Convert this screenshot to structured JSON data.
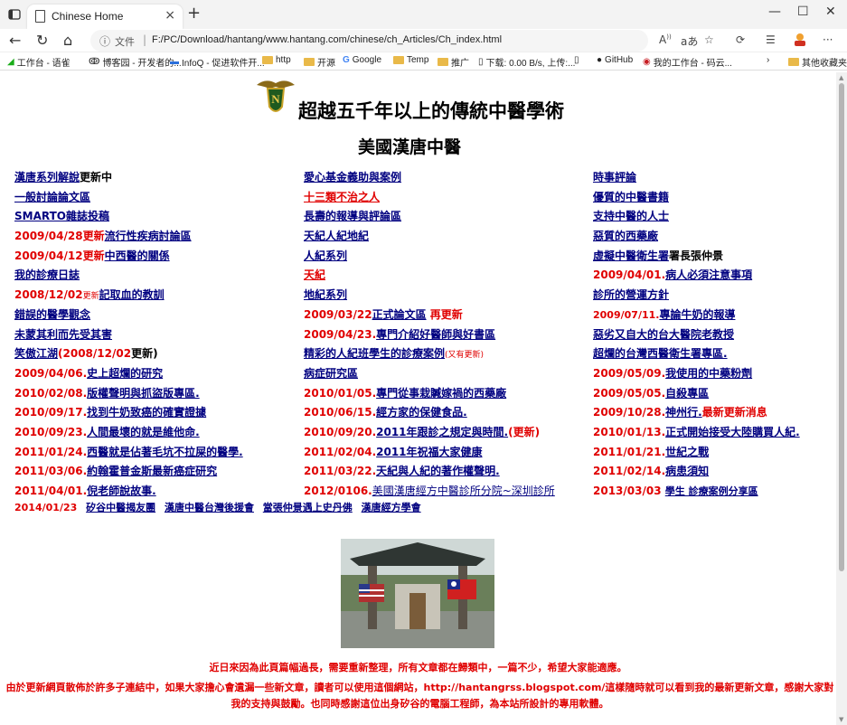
{
  "browser": {
    "tab_title": "Chinese Home",
    "url_scheme": "文件",
    "url": "F:/PC/Download/hantang/www.hantang.com/chinese/ch_Articles/Ch_index.html",
    "bookmarks": [
      {
        "label": "工作台 - 语雀",
        "icon": "yuque-icon"
      },
      {
        "label": "博客园 - 开发者的...",
        "icon": "cnblogs-icon"
      },
      {
        "label": "InfoQ - 促进软件开...",
        "icon": "infoq-icon"
      },
      {
        "label": "http",
        "icon": "folder-icon"
      },
      {
        "label": "开源",
        "icon": "folder-icon"
      },
      {
        "label": "Google",
        "icon": "google-icon"
      },
      {
        "label": "Temp",
        "icon": "folder-icon"
      },
      {
        "label": "推广",
        "icon": "folder-icon"
      },
      {
        "label": "下载: 0.00 B/s, 上传:...",
        "icon": "page-icon"
      },
      {
        "label": "",
        "icon": "page-icon"
      },
      {
        "label": "GitHub",
        "icon": "github-icon"
      },
      {
        "label": "我的工作台 - 码云...",
        "icon": "gitee-icon"
      },
      {
        "label": "其他收藏夹",
        "icon": "folder-icon"
      }
    ]
  },
  "header": {
    "title": "超越五千年以上的傳統中醫學術",
    "subtitle": "美國漢唐中醫"
  },
  "columns": {
    "left": [
      [
        {
          "t": "漢唐系列解說",
          "s": "link"
        },
        {
          "t": "更新中",
          "s": "plain"
        }
      ],
      [
        {
          "t": "一般討論論文區",
          "s": "link"
        }
      ],
      [
        {
          "t": "SMARTO雜誌投稿",
          "s": "link"
        }
      ],
      [
        {
          "t": "2009/04/28更新",
          "s": "red"
        },
        {
          "t": "流行性疾病討論區",
          "s": "link"
        }
      ],
      [
        {
          "t": "2009/04/12更新",
          "s": "red"
        },
        {
          "t": "中西醫的關係",
          "s": "link"
        }
      ],
      [
        {
          "t": "我的診療日誌",
          "s": "link"
        }
      ],
      [
        {
          "t": "2008/12/02",
          "s": "red"
        },
        {
          "t": "更新",
          "s": "redsmall"
        },
        {
          "t": "記取血的教訓",
          "s": "link"
        }
      ],
      [
        {
          "t": "錯誤的醫學觀念",
          "s": "link"
        }
      ],
      [
        {
          "t": "未蒙其利而先受其害",
          "s": "link"
        }
      ],
      [
        {
          "t": "笑傲江湖",
          "s": "link"
        },
        {
          "t": "(2008/12/02",
          "s": "red"
        },
        {
          "t": "更新)",
          "s": "plain"
        }
      ],
      [
        {
          "t": "2009/04/06.",
          "s": "red"
        },
        {
          "t": "史上超爛的研究",
          "s": "link"
        }
      ],
      [
        {
          "t": "2010/02/08.",
          "s": "red"
        },
        {
          "t": "版權聲明與抓盜版專區.",
          "s": "link"
        }
      ],
      [
        {
          "t": "2010/09/17.",
          "s": "red"
        },
        {
          "t": "找到牛奶致癌的確實證據",
          "s": "link"
        }
      ],
      [
        {
          "t": "2010/09/23.",
          "s": "red"
        },
        {
          "t": "人間最壞的就是維他命.",
          "s": "link"
        }
      ],
      [
        {
          "t": "2011/01/24.",
          "s": "red"
        },
        {
          "t": "西醫就是佔著毛坑不拉屎的醫學.",
          "s": "link"
        }
      ],
      [
        {
          "t": "2011/03/06.",
          "s": "red"
        },
        {
          "t": "約翰霍普金斯最新癌症研究",
          "s": "link"
        }
      ],
      [
        {
          "t": "2011/04/01.",
          "s": "red"
        },
        {
          "t": "倪老師說故事.",
          "s": "link"
        }
      ]
    ],
    "middle": [
      [
        {
          "t": "愛心基金義助與案例",
          "s": "link"
        }
      ],
      [
        {
          "t": "十三類不治之人",
          "s": "redlink"
        }
      ],
      [
        {
          "t": "長壽的報導與評論區",
          "s": "link"
        }
      ],
      [
        {
          "t": "天紀人紀地紀",
          "s": "link"
        }
      ],
      [
        {
          "t": "人紀系列",
          "s": "link"
        }
      ],
      [
        {
          "t": "天紀",
          "s": "redlink"
        }
      ],
      [
        {
          "t": "地紀系列",
          "s": "link"
        }
      ],
      [
        {
          "t": "2009/03/22",
          "s": "red"
        },
        {
          "t": "正式論文區",
          "s": "link"
        },
        {
          "t": " 再更新",
          "s": "red"
        }
      ],
      [
        {
          "t": "2009/04/23.",
          "s": "red"
        },
        {
          "t": "專門介紹好醫師與好書區",
          "s": "link"
        }
      ],
      [
        {
          "t": "精彩的人紀班學生的診療案例",
          "s": "link"
        },
        {
          "t": "(又有更新)",
          "s": "redsmall"
        }
      ],
      [
        {
          "t": "病症研究區",
          "s": "link"
        }
      ],
      [
        {
          "t": "2010/01/05.",
          "s": "red"
        },
        {
          "t": "專門從事栽贓嫁禍的西藥廠",
          "s": "link"
        }
      ],
      [
        {
          "t": "2010/06/15.",
          "s": "red"
        },
        {
          "t": "經方家的保健食品.",
          "s": "link"
        }
      ],
      [
        {
          "t": "2010/09/20.",
          "s": "red"
        },
        {
          "t": "2011年跟診之規定與時間.",
          "s": "link"
        },
        {
          "t": "(更新)",
          "s": "red"
        }
      ],
      [
        {
          "t": "2011/02/04.",
          "s": "red"
        },
        {
          "t": "2011年祝福大家健康",
          "s": "link"
        }
      ],
      [
        {
          "t": "2011/03/22.",
          "s": "red"
        },
        {
          "t": "天紀與人紀的著作權聲明.",
          "s": "link"
        }
      ],
      [
        {
          "t": "2012/0106.",
          "s": "red"
        },
        {
          "t": "美國漢唐經方中醫診所分院~深圳診所",
          "s": "linknormal"
        }
      ]
    ],
    "right": [
      [
        {
          "t": "時事評論",
          "s": "link"
        }
      ],
      [
        {
          "t": "優質的中醫書籍",
          "s": "link"
        }
      ],
      [
        {
          "t": "支持中醫的人士",
          "s": "link"
        }
      ],
      [
        {
          "t": "惡質的西藥廠",
          "s": "link"
        }
      ],
      [
        {
          "t": "虛擬中醫衛生署",
          "s": "link"
        },
        {
          "t": "署長張仲景",
          "s": "plain"
        }
      ],
      [
        {
          "t": "2009/04/01.",
          "s": "red"
        },
        {
          "t": "病人必須注意事項",
          "s": "link"
        }
      ],
      [
        {
          "t": "診所的營運方針",
          "s": "link"
        }
      ],
      [
        {
          "t": "2009/07/11.",
          "s": "redsm"
        },
        {
          "t": "專論牛奶的報導",
          "s": "link"
        }
      ],
      [
        {
          "t": "惡劣又自大的台大醫院老教授",
          "s": "link"
        }
      ],
      [
        {
          "t": "超爛的台灣西醫衛生署專區.",
          "s": "link"
        }
      ],
      [
        {
          "t": "2009/05/09.",
          "s": "red"
        },
        {
          "t": "我使用的中藥粉劑",
          "s": "link"
        }
      ],
      [
        {
          "t": "2009/05/05.",
          "s": "red"
        },
        {
          "t": "自殺專區",
          "s": "link"
        }
      ],
      [
        {
          "t": "2009/10/28.",
          "s": "red"
        },
        {
          "t": "神州行.",
          "s": "link"
        },
        {
          "t": "最新更新消息",
          "s": "red"
        }
      ],
      [
        {
          "t": "2010/01/13.",
          "s": "red"
        },
        {
          "t": "正式開始接受大陸購買人紀.",
          "s": "link"
        }
      ],
      [
        {
          "t": "2011/01/21.",
          "s": "red"
        },
        {
          "t": "世紀之戰",
          "s": "link"
        }
      ],
      [
        {
          "t": "2011/02/14.",
          "s": "red"
        },
        {
          "t": "病患須知",
          "s": "link"
        }
      ],
      [
        {
          "t": "2013/03/03 ",
          "s": "red"
        },
        {
          "t": "學生 診療案例分享區",
          "s": "linksmall"
        }
      ]
    ]
  },
  "bottom_links": {
    "date": "2014/01/23",
    "links": [
      "矽谷中醫揭友團",
      "漢唐中醫台灣後援會",
      "當張仲景遇上史丹佛",
      "漢唐經方學會"
    ]
  },
  "notices": {
    "line1": "近日來因為此頁篇幅過長，需要重新整理，所有文章都在歸類中，一篇不少，希望大家能適應。",
    "line2": "由於更新網頁散佈於許多子連結中，如果大家擔心會遺漏一些新文章，讀者可以使用這個網站，http://hantangrss.blogspot.com/這樣隨時就可以看到我的最新更新文章，感謝大家對我的支持與鼓勵。也同時感謝這位出身矽谷的電腦工程師，為本站所設計的專用軟體。"
  },
  "colors": {
    "link": "#000080",
    "accent_red": "#e00000"
  }
}
